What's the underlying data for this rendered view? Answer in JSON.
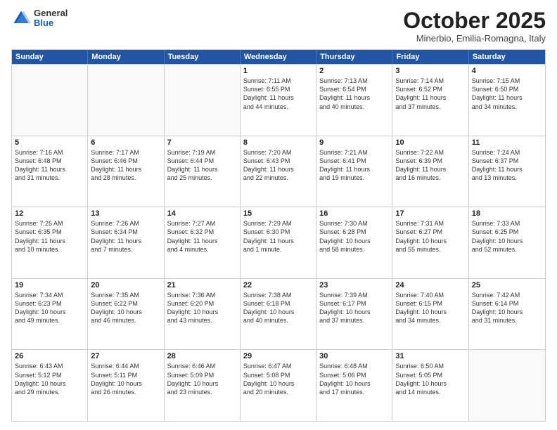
{
  "header": {
    "logo_general": "General",
    "logo_blue": "Blue",
    "month_title": "October 2025",
    "location": "Minerbio, Emilia-Romagna, Italy"
  },
  "days_of_week": [
    "Sunday",
    "Monday",
    "Tuesday",
    "Wednesday",
    "Thursday",
    "Friday",
    "Saturday"
  ],
  "weeks": [
    [
      {
        "day": "",
        "empty": true
      },
      {
        "day": "",
        "empty": true
      },
      {
        "day": "",
        "empty": true
      },
      {
        "day": "1",
        "lines": [
          "Sunrise: 7:11 AM",
          "Sunset: 6:55 PM",
          "Daylight: 11 hours",
          "and 44 minutes."
        ]
      },
      {
        "day": "2",
        "lines": [
          "Sunrise: 7:13 AM",
          "Sunset: 6:54 PM",
          "Daylight: 11 hours",
          "and 40 minutes."
        ]
      },
      {
        "day": "3",
        "lines": [
          "Sunrise: 7:14 AM",
          "Sunset: 6:52 PM",
          "Daylight: 11 hours",
          "and 37 minutes."
        ]
      },
      {
        "day": "4",
        "lines": [
          "Sunrise: 7:15 AM",
          "Sunset: 6:50 PM",
          "Daylight: 11 hours",
          "and 34 minutes."
        ]
      }
    ],
    [
      {
        "day": "5",
        "lines": [
          "Sunrise: 7:16 AM",
          "Sunset: 6:48 PM",
          "Daylight: 11 hours",
          "and 31 minutes."
        ]
      },
      {
        "day": "6",
        "lines": [
          "Sunrise: 7:17 AM",
          "Sunset: 6:46 PM",
          "Daylight: 11 hours",
          "and 28 minutes."
        ]
      },
      {
        "day": "7",
        "lines": [
          "Sunrise: 7:19 AM",
          "Sunset: 6:44 PM",
          "Daylight: 11 hours",
          "and 25 minutes."
        ]
      },
      {
        "day": "8",
        "lines": [
          "Sunrise: 7:20 AM",
          "Sunset: 6:43 PM",
          "Daylight: 11 hours",
          "and 22 minutes."
        ]
      },
      {
        "day": "9",
        "lines": [
          "Sunrise: 7:21 AM",
          "Sunset: 6:41 PM",
          "Daylight: 11 hours",
          "and 19 minutes."
        ]
      },
      {
        "day": "10",
        "lines": [
          "Sunrise: 7:22 AM",
          "Sunset: 6:39 PM",
          "Daylight: 11 hours",
          "and 16 minutes."
        ]
      },
      {
        "day": "11",
        "lines": [
          "Sunrise: 7:24 AM",
          "Sunset: 6:37 PM",
          "Daylight: 11 hours",
          "and 13 minutes."
        ]
      }
    ],
    [
      {
        "day": "12",
        "lines": [
          "Sunrise: 7:25 AM",
          "Sunset: 6:35 PM",
          "Daylight: 11 hours",
          "and 10 minutes."
        ]
      },
      {
        "day": "13",
        "lines": [
          "Sunrise: 7:26 AM",
          "Sunset: 6:34 PM",
          "Daylight: 11 hours",
          "and 7 minutes."
        ]
      },
      {
        "day": "14",
        "lines": [
          "Sunrise: 7:27 AM",
          "Sunset: 6:32 PM",
          "Daylight: 11 hours",
          "and 4 minutes."
        ]
      },
      {
        "day": "15",
        "lines": [
          "Sunrise: 7:29 AM",
          "Sunset: 6:30 PM",
          "Daylight: 11 hours",
          "and 1 minute."
        ]
      },
      {
        "day": "16",
        "lines": [
          "Sunrise: 7:30 AM",
          "Sunset: 6:28 PM",
          "Daylight: 10 hours",
          "and 58 minutes."
        ]
      },
      {
        "day": "17",
        "lines": [
          "Sunrise: 7:31 AM",
          "Sunset: 6:27 PM",
          "Daylight: 10 hours",
          "and 55 minutes."
        ]
      },
      {
        "day": "18",
        "lines": [
          "Sunrise: 7:33 AM",
          "Sunset: 6:25 PM",
          "Daylight: 10 hours",
          "and 52 minutes."
        ]
      }
    ],
    [
      {
        "day": "19",
        "lines": [
          "Sunrise: 7:34 AM",
          "Sunset: 6:23 PM",
          "Daylight: 10 hours",
          "and 49 minutes."
        ]
      },
      {
        "day": "20",
        "lines": [
          "Sunrise: 7:35 AM",
          "Sunset: 6:22 PM",
          "Daylight: 10 hours",
          "and 46 minutes."
        ]
      },
      {
        "day": "21",
        "lines": [
          "Sunrise: 7:36 AM",
          "Sunset: 6:20 PM",
          "Daylight: 10 hours",
          "and 43 minutes."
        ]
      },
      {
        "day": "22",
        "lines": [
          "Sunrise: 7:38 AM",
          "Sunset: 6:18 PM",
          "Daylight: 10 hours",
          "and 40 minutes."
        ]
      },
      {
        "day": "23",
        "lines": [
          "Sunrise: 7:39 AM",
          "Sunset: 6:17 PM",
          "Daylight: 10 hours",
          "and 37 minutes."
        ]
      },
      {
        "day": "24",
        "lines": [
          "Sunrise: 7:40 AM",
          "Sunset: 6:15 PM",
          "Daylight: 10 hours",
          "and 34 minutes."
        ]
      },
      {
        "day": "25",
        "lines": [
          "Sunrise: 7:42 AM",
          "Sunset: 6:14 PM",
          "Daylight: 10 hours",
          "and 31 minutes."
        ]
      }
    ],
    [
      {
        "day": "26",
        "lines": [
          "Sunrise: 6:43 AM",
          "Sunset: 5:12 PM",
          "Daylight: 10 hours",
          "and 29 minutes."
        ]
      },
      {
        "day": "27",
        "lines": [
          "Sunrise: 6:44 AM",
          "Sunset: 5:11 PM",
          "Daylight: 10 hours",
          "and 26 minutes."
        ]
      },
      {
        "day": "28",
        "lines": [
          "Sunrise: 6:46 AM",
          "Sunset: 5:09 PM",
          "Daylight: 10 hours",
          "and 23 minutes."
        ]
      },
      {
        "day": "29",
        "lines": [
          "Sunrise: 6:47 AM",
          "Sunset: 5:08 PM",
          "Daylight: 10 hours",
          "and 20 minutes."
        ]
      },
      {
        "day": "30",
        "lines": [
          "Sunrise: 6:48 AM",
          "Sunset: 5:06 PM",
          "Daylight: 10 hours",
          "and 17 minutes."
        ]
      },
      {
        "day": "31",
        "lines": [
          "Sunrise: 6:50 AM",
          "Sunset: 5:05 PM",
          "Daylight: 10 hours",
          "and 14 minutes."
        ]
      },
      {
        "day": "",
        "empty": true
      }
    ]
  ]
}
